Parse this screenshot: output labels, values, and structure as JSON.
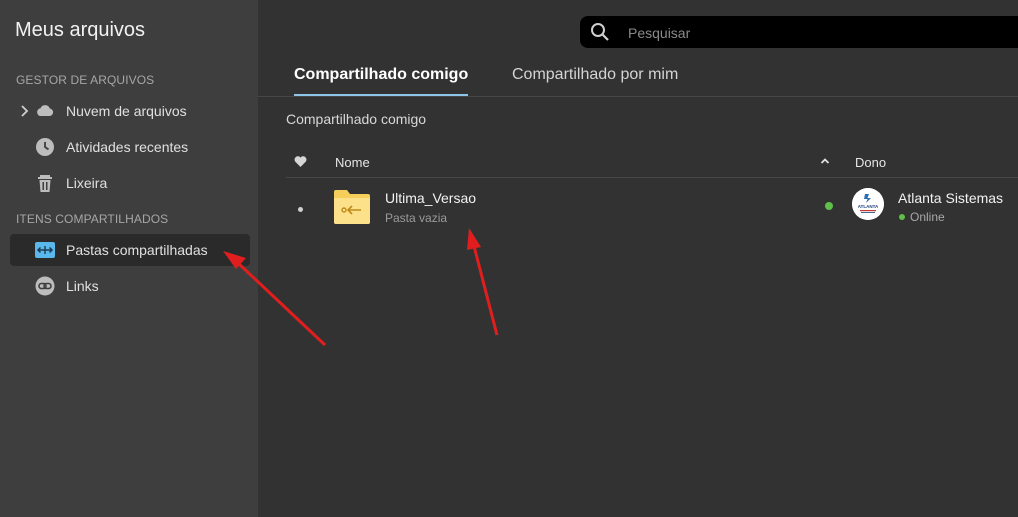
{
  "sidebar": {
    "title": "Meus arquivos",
    "sections": [
      {
        "title": "GESTOR DE ARQUIVOS",
        "items": [
          {
            "label": "Nuvem de arquivos",
            "icon": "cloud-icon"
          },
          {
            "label": "Atividades recentes",
            "icon": "clock-icon"
          },
          {
            "label": "Lixeira",
            "icon": "trash-icon"
          }
        ]
      },
      {
        "title": "ITENS COMPARTILHADOS",
        "items": [
          {
            "label": "Pastas compartilhadas",
            "icon": "shared-folder-icon",
            "active": true
          },
          {
            "label": "Links",
            "icon": "link-icon"
          }
        ]
      }
    ]
  },
  "search": {
    "placeholder": "Pesquisar"
  },
  "tabs": [
    {
      "label": "Compartilhado comigo",
      "active": true
    },
    {
      "label": "Compartilhado por mim",
      "active": false
    }
  ],
  "breadcrumb": "Compartilhado comigo",
  "table": {
    "columns": {
      "name": "Nome",
      "owner": "Dono"
    },
    "rows": [
      {
        "name": "Ultima_Versao",
        "subtitle": "Pasta vazia",
        "owner": "Atlanta Sistemas",
        "owner_status": "Online",
        "avatar_text": "ATLANTA"
      }
    ]
  },
  "colors": {
    "accent_tab": "#8fc4ea",
    "online": "#5fbf4a",
    "folder": "#f5cf5a",
    "annotation_arrow": "#e01e1e"
  }
}
